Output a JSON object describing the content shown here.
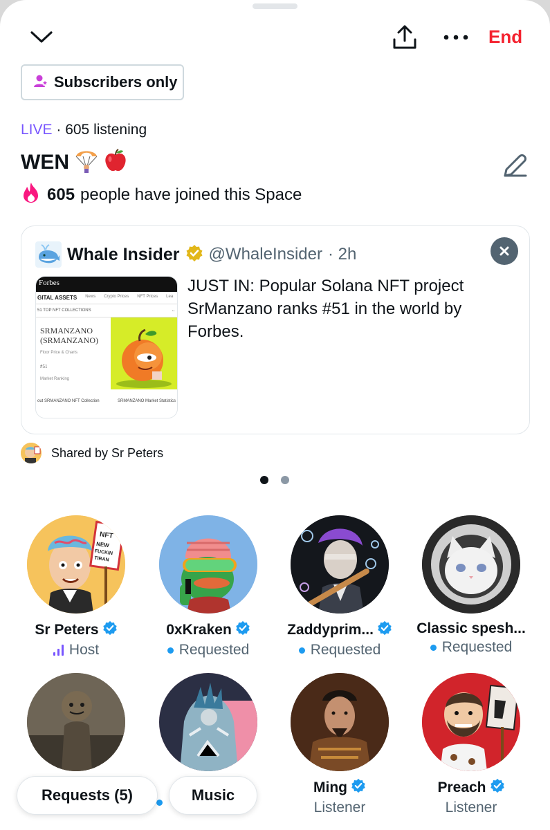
{
  "header": {
    "collapse_icon": "chevron-down-icon",
    "share_icon": "share-upload-icon",
    "more_icon": "more-horizontal-icon",
    "end_label": "End"
  },
  "badge": {
    "icon": "subscribers-icon",
    "label": "Subscribers only"
  },
  "status": {
    "live": "LIVE",
    "sep": " · ",
    "listening": "605 listening"
  },
  "space": {
    "title": "WEN",
    "title_emojis": "parachute-icon, apple-icon",
    "joined_count": "605",
    "joined_text": "people have joined this Space"
  },
  "tweet": {
    "author": "Whale Insider",
    "handle": "@WhaleInsider",
    "time": "· 2h",
    "text": "JUST IN: Popular Solana NFT project SrManzano ranks #51 in the world by Forbes.",
    "thumb": {
      "brand": "Forbes",
      "section": "GITAL ASSETS",
      "tabs": [
        "News",
        "Crypto Prices",
        "NFT Prices",
        "Lea"
      ],
      "nav": "51  TOP NFT COLLECTIONS",
      "project": "SRMANZANO (SRMANZANO)",
      "sub": "Floor Price & Charts",
      "rank": "#51",
      "rank_label": "Market Ranking",
      "foot_left": "out SRMANZANO NFT Collection",
      "foot_right": "SRMANZANO Market Statistics"
    }
  },
  "shared_by": "Shared by Sr Peters",
  "pagination": {
    "current": 1,
    "total": 2
  },
  "participants": [
    {
      "name": "Sr Peters",
      "role": "Host",
      "verified": true
    },
    {
      "name": "0xKraken",
      "role": "Requested",
      "verified": true
    },
    {
      "name": "Zaddyprim...",
      "role": "Requested",
      "verified": true
    },
    {
      "name": "Classic spesh...",
      "role": "Requested",
      "verified": false
    },
    {
      "name": "",
      "role": "",
      "verified": false
    },
    {
      "name": "",
      "role": "",
      "verified": false
    },
    {
      "name": "Ming",
      "role": "Listener",
      "verified": true
    },
    {
      "name": "Preach",
      "role": "Listener",
      "verified": true
    }
  ],
  "bottom": {
    "requests_label": "Requests (5)",
    "music_label": "Music"
  },
  "colors": {
    "live": "#7856ff",
    "end": "#f4212e",
    "verified": "#1d9bf0",
    "muted": "#536471"
  }
}
